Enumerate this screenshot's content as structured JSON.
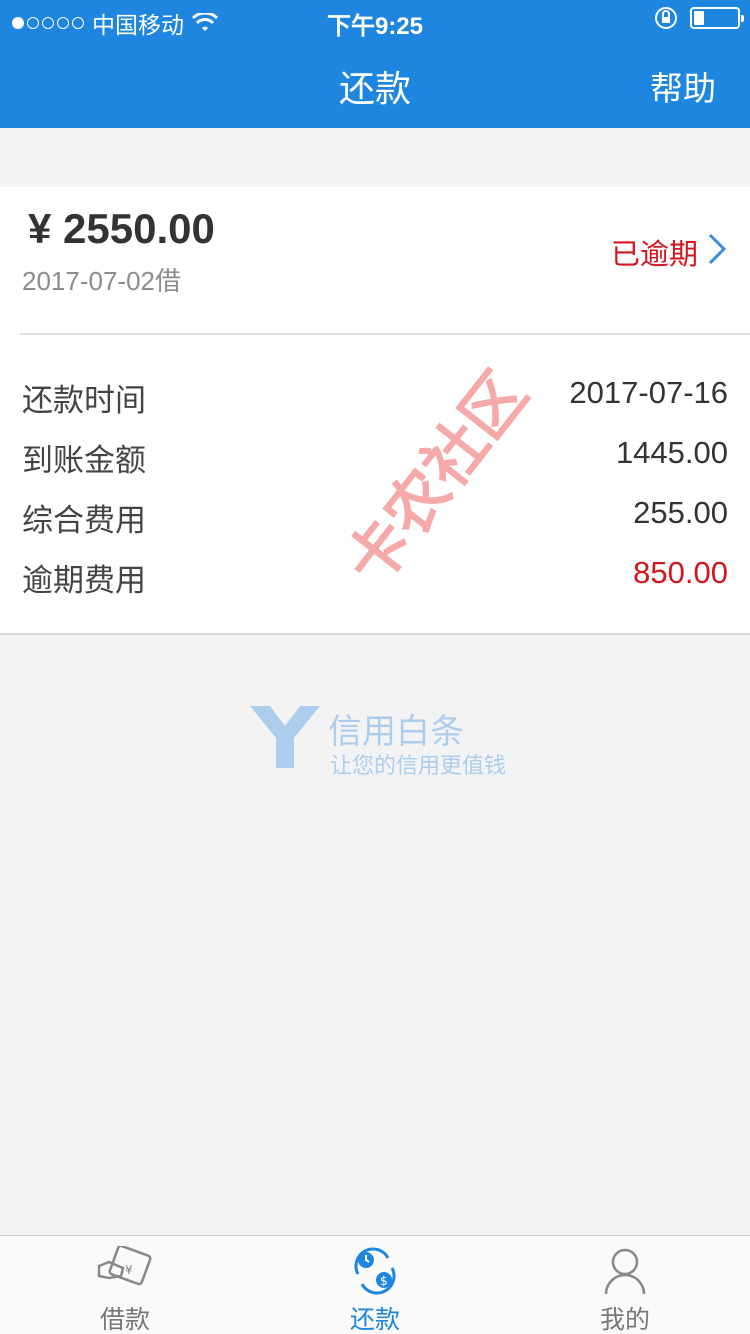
{
  "status_bar": {
    "carrier": "中国移动",
    "time": "下午9:25"
  },
  "nav": {
    "title": "还款",
    "help": "帮助"
  },
  "loan": {
    "amount": "¥ 2550.00",
    "borrow_date": "2017-07-02借",
    "status": "已逾期",
    "status_color": "#d4161c"
  },
  "details": [
    {
      "label": "还款时间",
      "value": "2017-07-16"
    },
    {
      "label": "到账金额",
      "value": "1445.00"
    },
    {
      "label": "综合费用",
      "value": "255.00"
    },
    {
      "label": "逾期费用",
      "value": "850.00"
    }
  ],
  "watermark": {
    "brand": "信用白条",
    "slogan": "让您的信用更值钱",
    "stamp": "卡农社区"
  },
  "tabs": [
    {
      "label": "借款",
      "icon": "borrow-card-icon"
    },
    {
      "label": "还款",
      "icon": "repay-cycle-icon"
    },
    {
      "label": "我的",
      "icon": "user-icon"
    }
  ],
  "colors": {
    "primary": "#1f86e0",
    "danger": "#d4161c"
  }
}
